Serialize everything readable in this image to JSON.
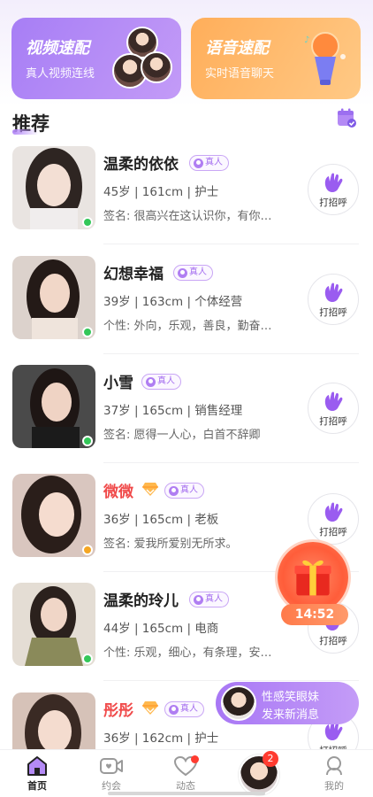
{
  "cards": {
    "video": {
      "title": "视频速配",
      "subtitle": "真人视频连线"
    },
    "voice": {
      "title": "语音速配",
      "subtitle": "实时语音聊天"
    }
  },
  "section": {
    "title": "推荐"
  },
  "badge_label": "真人",
  "greet_label": "打招呼",
  "users": [
    {
      "name": "温柔的依依",
      "meta": "45岁 | 161cm | 护士",
      "bio": "签名: 很高兴在这认识你，有你…",
      "status": "online",
      "vip": false
    },
    {
      "name": "幻想幸福",
      "meta": "39岁 | 163cm | 个体经营",
      "bio": "个性: 外向，乐观，善良，勤奋…",
      "status": "online",
      "vip": false
    },
    {
      "name": "小雪",
      "meta": "37岁 | 165cm | 销售经理",
      "bio": "签名: 愿得一人心，白首不辞卿",
      "status": "online",
      "vip": false
    },
    {
      "name": "微微",
      "meta": "36岁 | 165cm | 老板",
      "bio": "签名: 爱我所爱别无所求。",
      "status": "busy",
      "vip": true
    },
    {
      "name": "温柔的玲儿",
      "meta": "44岁 | 165cm | 电商",
      "bio": "个性: 乐观，细心，有条理，安…",
      "status": "online",
      "vip": false
    },
    {
      "name": "彤彤",
      "meta": "36岁 | 162cm | 护士",
      "bio": "",
      "status": "none",
      "vip": true
    }
  ],
  "gift": {
    "timer": "14:52"
  },
  "toast": {
    "line1": "性感笑眼妹",
    "line2": "发来新消息"
  },
  "nav": {
    "home": "首页",
    "date": "约会",
    "moments": "动态",
    "messages_badge": "2",
    "me": "我的"
  },
  "colors": {
    "accent_purple": "#a77ef5",
    "accent_orange": "#ffae5a",
    "online": "#34c759",
    "busy": "#f5a623",
    "vip_name": "#f04a4a"
  }
}
